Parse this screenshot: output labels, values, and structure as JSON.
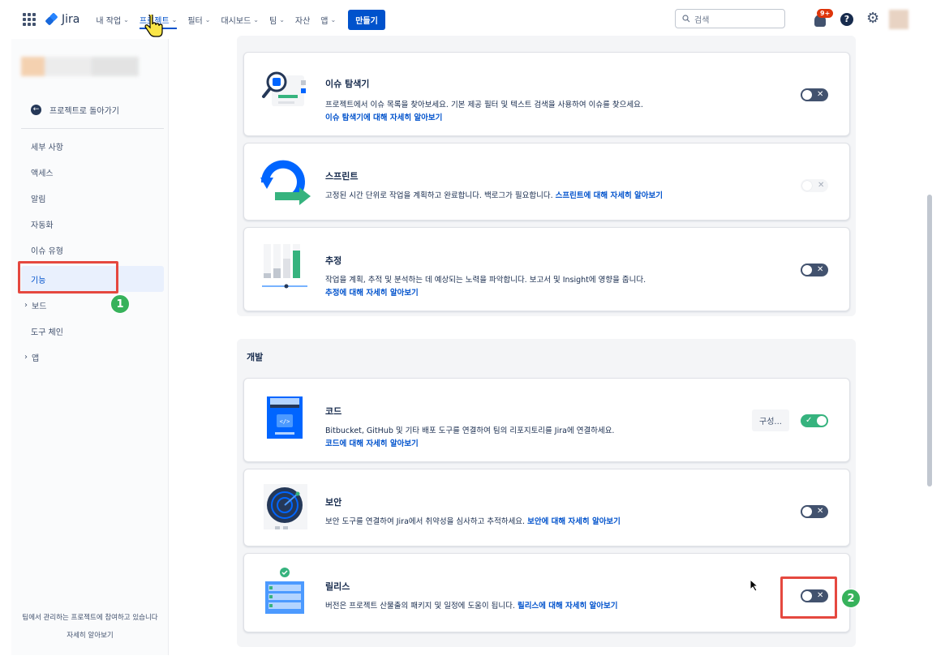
{
  "topnav": {
    "logo_text": "Jira",
    "items": [
      {
        "label": "내 작업",
        "chevron": "⌄"
      },
      {
        "label": "프로젝트",
        "chevron": "⌄"
      },
      {
        "label": "필터",
        "chevron": "⌄"
      },
      {
        "label": "대시보드",
        "chevron": "⌄"
      },
      {
        "label": "팀",
        "chevron": "⌄"
      },
      {
        "label": "자산",
        "chevron": ""
      },
      {
        "label": "앱",
        "chevron": "⌄"
      }
    ],
    "create_label": "만들기",
    "search_placeholder": "검색",
    "notification_badge": "9+",
    "help_label": "?"
  },
  "sidebar": {
    "back_label": "프로젝트로 돌아가기",
    "items": [
      {
        "label": "세부 사항",
        "caret": ""
      },
      {
        "label": "액세스",
        "caret": ""
      },
      {
        "label": "알림",
        "caret": ""
      },
      {
        "label": "자동화",
        "caret": ""
      },
      {
        "label": "이슈 유형",
        "caret": ""
      },
      {
        "label": "기능",
        "caret": ""
      },
      {
        "label": "보드",
        "caret": "›"
      },
      {
        "label": "도구 체인",
        "caret": ""
      },
      {
        "label": "앱",
        "caret": "›"
      }
    ],
    "footer_text": "팀에서 관리하는 프로젝트에 참여하고 있습니다",
    "footer_link": "자세히 알아보기"
  },
  "features": {
    "issue_navigator": {
      "title": "이슈 탐색기",
      "desc": "프로젝트에서 이슈 목록을 찾아보세요. 기본 제공 필터 및 텍스트 검색을 사용하여 이슈를 찾으세요.",
      "link": "이슈 탐색기에 대해 자세히 알아보기",
      "toggle_mark": "✕"
    },
    "sprint": {
      "title": "스프린트",
      "desc": "고정된 시간 단위로 작업을 계획하고 완료합니다. 백로그가 필요합니다.",
      "link": "스프린트에 대해 자세히 알아보기",
      "toggle_mark": "✕"
    },
    "estimation": {
      "title": "추정",
      "desc": "작업을 계획, 추적 및 분석하는 데 예상되는 노력을 파악합니다. 보고서 및 Insight에 영향을 줍니다.",
      "link": "추정에 대해 자세히 알아보기",
      "toggle_mark": "✕"
    }
  },
  "development": {
    "section_label": "개발",
    "code": {
      "title": "코드",
      "desc": "Bitbucket, GitHub 및 기타 배포 도구를 연결하여 팀의 리포지토리를 Jira에 연결하세요.",
      "link": "코드에 대해 자세히 알아보기",
      "config_label": "구성...",
      "toggle_mark": "✓"
    },
    "security": {
      "title": "보안",
      "desc": "보안 도구를 연결하여 Jira에서 취약성을 심사하고 추적하세요.",
      "link": "보안에 대해 자세히 알아보기",
      "toggle_mark": "✕"
    },
    "releases": {
      "title": "릴리스",
      "desc": "버전은 프로젝트 산물출의 패키지 및 일정에 도움이 됩니다.",
      "link": "릴리스에 대해 자세히 알아보기",
      "toggle_mark": "✕"
    }
  },
  "markers": {
    "one": "1",
    "two": "2"
  },
  "colors": {
    "brand": "#0052cc",
    "highlight": "#e5483f",
    "marker": "#37b25b",
    "toggle_on": "#36b37e",
    "toggle_off": "#42526e"
  }
}
